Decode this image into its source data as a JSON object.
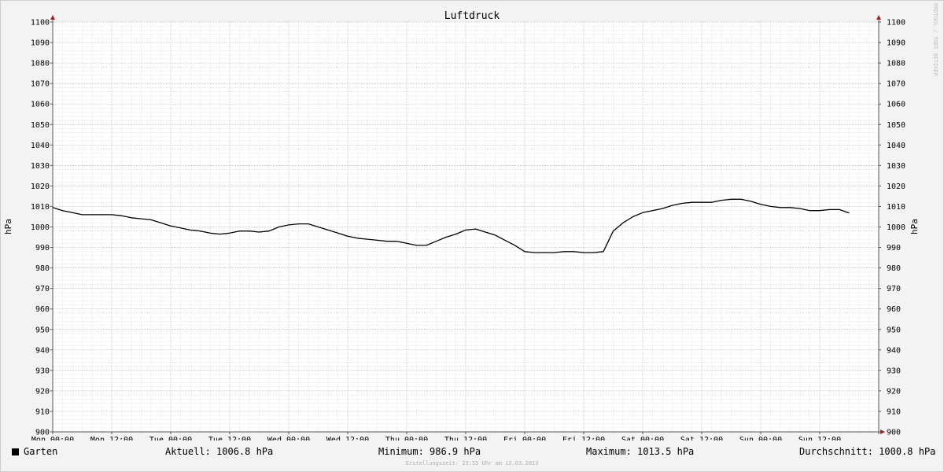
{
  "chart_data": {
    "type": "line",
    "title": "Luftdruck",
    "ylabel_left": "hPa",
    "ylabel_right": "hPa",
    "ylim": [
      900,
      1100
    ],
    "y_ticks": [
      "900",
      "910",
      "920",
      "930",
      "940",
      "950",
      "960",
      "970",
      "980",
      "990",
      "1000",
      "1010",
      "1020",
      "1030",
      "1040",
      "1050",
      "1060",
      "1070",
      "1080",
      "1090",
      "1100"
    ],
    "x_range_hours": [
      0,
      168
    ],
    "x_ticks": [
      {
        "label": "Mon 00:00",
        "hour": 0
      },
      {
        "label": "Mon 12:00",
        "hour": 12
      },
      {
        "label": "Tue 00:00",
        "hour": 24
      },
      {
        "label": "Tue 12:00",
        "hour": 36
      },
      {
        "label": "Wed 00:00",
        "hour": 48
      },
      {
        "label": "Wed 12:00",
        "hour": 60
      },
      {
        "label": "Thu 00:00",
        "hour": 72
      },
      {
        "label": "Thu 12:00",
        "hour": 84
      },
      {
        "label": "Fri 00:00",
        "hour": 96
      },
      {
        "label": "Fri 12:00",
        "hour": 108
      },
      {
        "label": "Sat 00:00",
        "hour": 120
      },
      {
        "label": "Sat 12:00",
        "hour": 132
      },
      {
        "label": "Sun 00:00",
        "hour": 144
      },
      {
        "label": "Sun 12:00",
        "hour": 156
      }
    ],
    "grid": true,
    "series": [
      {
        "name": "Garten",
        "color": "#000000",
        "x_hours": [
          0,
          2,
          4,
          6,
          8,
          10,
          12,
          14,
          16,
          18,
          20,
          22,
          24,
          26,
          28,
          30,
          32,
          34,
          36,
          38,
          40,
          42,
          44,
          46,
          48,
          50,
          52,
          54,
          56,
          58,
          60,
          62,
          64,
          66,
          68,
          70,
          72,
          74,
          76,
          78,
          80,
          82,
          84,
          86,
          88,
          90,
          92,
          94,
          96,
          98,
          100,
          102,
          104,
          106,
          108,
          110,
          112,
          113,
          114,
          116,
          118,
          120,
          122,
          124,
          126,
          128,
          130,
          132,
          134,
          136,
          138,
          140,
          142,
          144,
          146,
          148,
          150,
          152,
          154,
          156,
          158,
          160,
          162,
          164,
          166,
          168
        ],
        "values": [
          1009.5,
          1008,
          1007,
          1006,
          1006,
          1006,
          1006,
          1005.5,
          1004.5,
          1004,
          1003.5,
          1002,
          1000.5,
          999.5,
          998.5,
          998,
          997,
          996.5,
          997,
          998,
          998,
          997.5,
          998,
          1000,
          1001,
          1001.5,
          1001.5,
          1000,
          998.5,
          997,
          995.5,
          994.5,
          994,
          993.5,
          993,
          993,
          992,
          991,
          991,
          993,
          995,
          996.5,
          998.5,
          999,
          997.5,
          996,
          993.5,
          991,
          988,
          987.5,
          987.5,
          987.5,
          988,
          988,
          987.5,
          987.5,
          988,
          993,
          998,
          1002,
          1005,
          1007,
          1008,
          1009,
          1010.5,
          1011.5,
          1012,
          1012,
          1012,
          1013,
          1013.5,
          1013.5,
          1012.5,
          1011,
          1010,
          1009.5,
          1009.5,
          1009,
          1008,
          1008,
          1008.5,
          1008.5,
          1006.8
        ]
      }
    ]
  },
  "legend": {
    "series_name": "Garten",
    "current": "Aktuell: 1006.8 hPa",
    "minimum": "Minimum: 986.9 hPa",
    "maximum": "Maximum: 1013.5 hPa",
    "average": "Durchschnitt: 1000.8 hPa"
  },
  "footer_note": "Erstellungszeit: 23:55 Uhr am 12.03.2023",
  "watermark": "RRDTOOL / TOBI OETIKER"
}
